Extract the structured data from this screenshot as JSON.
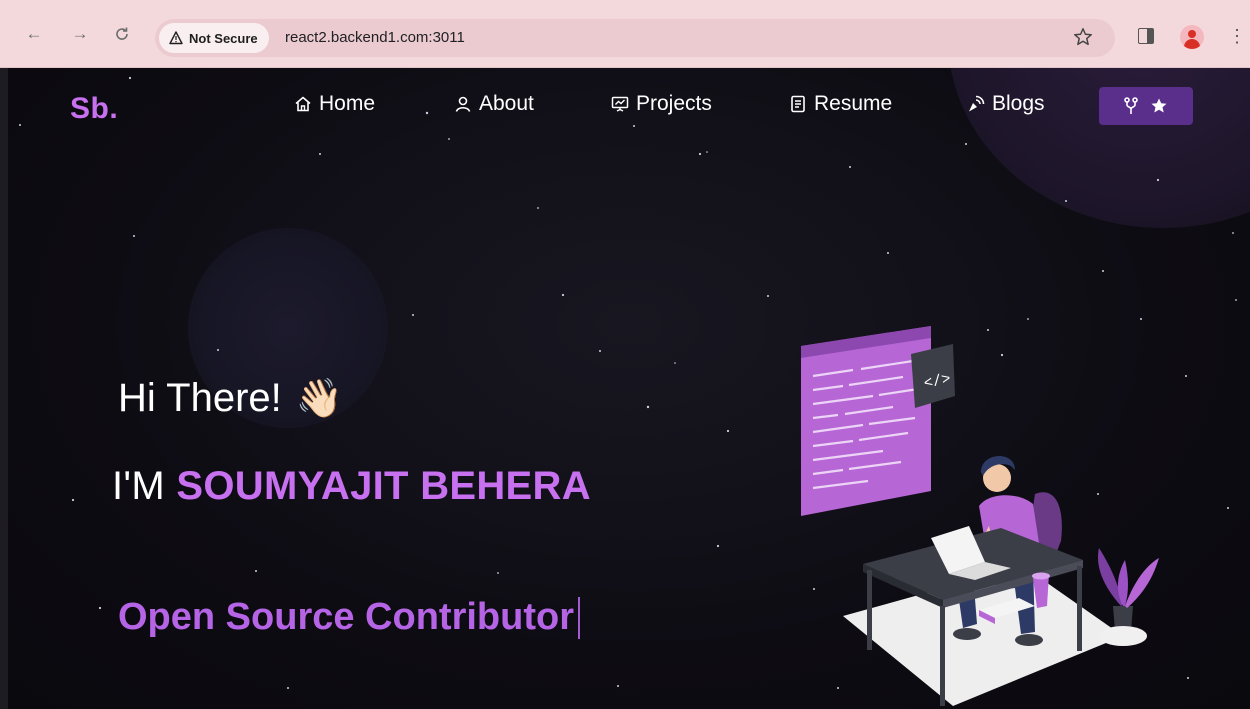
{
  "browser": {
    "security_label": "Not Secure",
    "url": "react2.backend1.com:3011"
  },
  "navbar": {
    "logo": "Sb.",
    "items": [
      {
        "label": "Home",
        "icon": "home-icon"
      },
      {
        "label": "About",
        "icon": "user-icon"
      },
      {
        "label": "Projects",
        "icon": "projects-icon"
      },
      {
        "label": "Resume",
        "icon": "resume-icon"
      },
      {
        "label": "Blogs",
        "icon": "blogs-icon"
      }
    ],
    "github_button": {
      "icons": [
        "fork-icon",
        "star-icon"
      ]
    }
  },
  "hero": {
    "greeting": "Hi There!",
    "greeting_emoji": "👋🏻",
    "intro_prefix": "I'M",
    "name": "SOUMYAJIT BEHERA",
    "typed_text": "Open Source Contributor"
  },
  "colors": {
    "accent": "#c770f0",
    "button_bg": "#5a2f8c",
    "background": "#0e0c13"
  }
}
